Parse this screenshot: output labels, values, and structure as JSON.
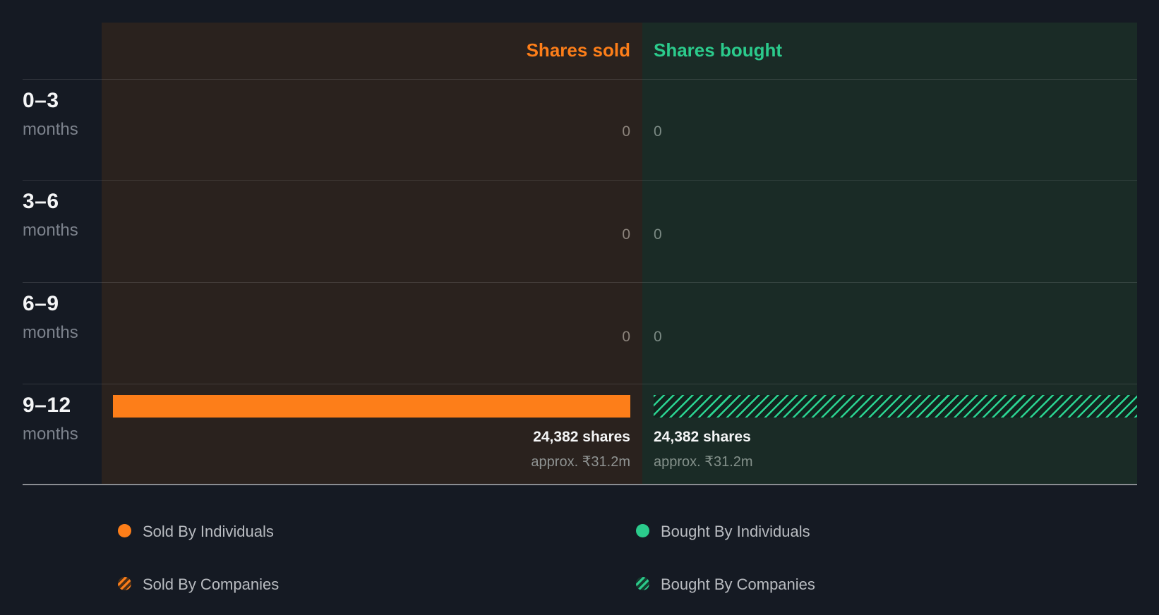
{
  "chart_data": {
    "type": "bar",
    "orientation": "horizontal",
    "title": "",
    "columns": [
      {
        "id": "sold",
        "label": "Shares sold",
        "color": "#fd7e19"
      },
      {
        "id": "bought",
        "label": "Shares bought",
        "color": "#2bcb8c"
      }
    ],
    "xlim": [
      0,
      24382
    ],
    "rows": [
      {
        "period": "0–3",
        "unit": "months",
        "sold_shares": 0,
        "bought_shares": 0,
        "sold_display": "0",
        "bought_display": "0"
      },
      {
        "period": "3–6",
        "unit": "months",
        "sold_shares": 0,
        "bought_shares": 0,
        "sold_display": "0",
        "bought_display": "0"
      },
      {
        "period": "6–9",
        "unit": "months",
        "sold_shares": 0,
        "bought_shares": 0,
        "sold_display": "0",
        "bought_display": "0"
      },
      {
        "period": "9–12",
        "unit": "months",
        "sold_shares": 24382,
        "sold_display": "24,382 shares",
        "sold_approx": "approx. ₹31.2m",
        "sold_pattern": "solid",
        "bought_shares": 24382,
        "bought_display": "24,382 shares",
        "bought_approx": "approx. ₹31.2m",
        "bought_pattern": "hatched"
      }
    ],
    "legend": [
      {
        "label": "Sold By Individuals",
        "swatch": "solid-orange"
      },
      {
        "label": "Sold By Companies",
        "swatch": "hatched-orange"
      },
      {
        "label": "Bought By Individuals",
        "swatch": "solid-green"
      },
      {
        "label": "Bought By Companies",
        "swatch": "hatched-green"
      }
    ],
    "layout": {
      "grid": true,
      "legend_position": "bottom"
    }
  },
  "colors": {
    "background": "#151a23",
    "sold_panel": "#2a221e",
    "bought_panel": "#1a2b26",
    "accent_orange": "#fd7e19",
    "accent_green": "#2bcb8c",
    "text_primary": "#f4f5f6",
    "text_muted": "#7c828c"
  }
}
